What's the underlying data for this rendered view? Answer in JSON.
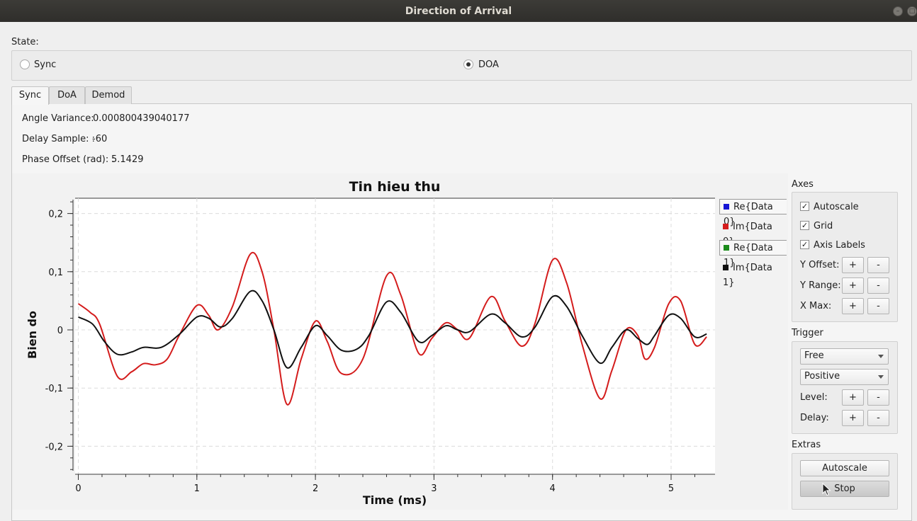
{
  "window": {
    "title": "Direction of Arrival"
  },
  "state": {
    "label": "State:",
    "options": [
      {
        "label": "Sync",
        "checked": false
      },
      {
        "label": "DOA",
        "checked": true
      }
    ]
  },
  "tabs": [
    {
      "label": "Sync",
      "active": true
    },
    {
      "label": "DoA",
      "active": false
    },
    {
      "label": "Demod",
      "active": false
    }
  ],
  "info": {
    "angle_variance_label": "Angle Variance:",
    "angle_variance_value": "0.000800439040177",
    "delay_sample_label": "Delay Sample: :",
    "delay_sample_value": "-60",
    "phase_offset_label": "Phase Offset (rad): :",
    "phase_offset_value": "5.1429"
  },
  "chart_data": {
    "type": "line",
    "title": "Tin hieu thu",
    "xlabel": "Time (ms)",
    "ylabel": "Bien do",
    "xlim": [
      0,
      5.35
    ],
    "ylim": [
      -0.24,
      0.225
    ],
    "x_ticks": [
      0,
      1,
      2,
      3,
      4,
      5
    ],
    "x_tick_labels": [
      "0",
      "1",
      "2",
      "3",
      "4",
      "5"
    ],
    "y_ticks": [
      0.2,
      0.1,
      0,
      -0.1,
      -0.2
    ],
    "y_tick_labels": [
      "0,2",
      "0,1",
      "0",
      "-0,1",
      "-0,2"
    ],
    "grid": true,
    "legend_position": "right",
    "series": [
      {
        "name": "Im{Data 0}",
        "color": "#d41c1c",
        "x": [
          0,
          0.1,
          0.18,
          0.33,
          0.45,
          0.55,
          0.65,
          0.75,
          0.85,
          1.0,
          1.1,
          1.18,
          1.3,
          1.45,
          1.55,
          1.65,
          1.76,
          1.88,
          2.0,
          2.1,
          2.22,
          2.4,
          2.6,
          2.72,
          2.87,
          2.98,
          3.1,
          3.2,
          3.3,
          3.48,
          3.6,
          3.74,
          3.85,
          4.0,
          4.12,
          4.25,
          4.4,
          4.5,
          4.62,
          4.72,
          4.78,
          4.86,
          4.98,
          5.08,
          5.2,
          5.3
        ],
        "values": [
          0.045,
          0.03,
          0.01,
          -0.08,
          -0.072,
          -0.058,
          -0.06,
          -0.05,
          -0.01,
          0.042,
          0.025,
          0.0,
          0.04,
          0.13,
          0.1,
          0.0,
          -0.128,
          -0.05,
          0.015,
          -0.02,
          -0.075,
          -0.05,
          0.093,
          0.06,
          -0.04,
          -0.015,
          0.012,
          0.0,
          -0.014,
          0.057,
          0.015,
          -0.028,
          0.01,
          0.12,
          0.08,
          -0.025,
          -0.118,
          -0.07,
          0.0,
          -0.01,
          -0.05,
          -0.03,
          0.045,
          0.05,
          -0.025,
          -0.012
        ]
      },
      {
        "name": "Im{Data 1}",
        "color": "#111111",
        "x": [
          0,
          0.12,
          0.22,
          0.33,
          0.45,
          0.55,
          0.7,
          0.85,
          1.0,
          1.1,
          1.2,
          1.3,
          1.45,
          1.55,
          1.65,
          1.76,
          1.88,
          2.0,
          2.1,
          2.22,
          2.35,
          2.45,
          2.6,
          2.72,
          2.87,
          2.98,
          3.1,
          3.2,
          3.3,
          3.48,
          3.6,
          3.74,
          3.85,
          4.0,
          4.12,
          4.25,
          4.4,
          4.5,
          4.62,
          4.72,
          4.8,
          4.86,
          4.98,
          5.08,
          5.2,
          5.3
        ],
        "values": [
          0.022,
          0.01,
          -0.02,
          -0.042,
          -0.038,
          -0.03,
          -0.03,
          -0.008,
          0.022,
          0.02,
          0.005,
          0.02,
          0.066,
          0.05,
          0.0,
          -0.065,
          -0.03,
          0.007,
          -0.01,
          -0.035,
          -0.033,
          -0.01,
          0.048,
          0.03,
          -0.02,
          -0.01,
          0.007,
          0.0,
          -0.003,
          0.027,
          0.012,
          -0.012,
          0.004,
          0.057,
          0.04,
          -0.01,
          -0.057,
          -0.03,
          0.0,
          -0.015,
          -0.025,
          -0.01,
          0.025,
          0.02,
          -0.012,
          -0.007
        ]
      },
      {
        "name": "Re{Data 0}",
        "color": "#1414d4",
        "x": [],
        "values": []
      },
      {
        "name": "Re{Data 1}",
        "color": "#1a8a1a",
        "x": [],
        "values": []
      }
    ]
  },
  "legend": [
    {
      "label": "Re{Data 0}",
      "color": "#1414d4",
      "boxed": true
    },
    {
      "label": "Im{Data 0}",
      "color": "#d41c1c",
      "boxed": false
    },
    {
      "label": "Re{Data 1}",
      "color": "#1a8a1a",
      "boxed": true
    },
    {
      "label": "Im{Data 1}",
      "color": "#111111",
      "boxed": false
    }
  ],
  "axes_panel": {
    "title": "Axes",
    "autoscale_label": "Autoscale",
    "autoscale_checked": true,
    "grid_label": "Grid",
    "grid_checked": true,
    "axis_labels_label": "Axis Labels",
    "axis_labels_checked": true,
    "y_offset_label": "Y Offset:",
    "y_range_label": "Y Range:",
    "x_max_label": "X Max:",
    "plus": "+",
    "minus": "-"
  },
  "trigger_panel": {
    "title": "Trigger",
    "mode_value": "Free",
    "slope_value": "Positive",
    "level_label": "Level:",
    "delay_label": "Delay:"
  },
  "extras_panel": {
    "title": "Extras",
    "autoscale_button": "Autoscale",
    "stop_button": "Stop"
  },
  "colors": {
    "titlebar": "#3c3b37",
    "window_bg": "#efefef",
    "im0": "#d41c1c",
    "im1": "#111111"
  }
}
